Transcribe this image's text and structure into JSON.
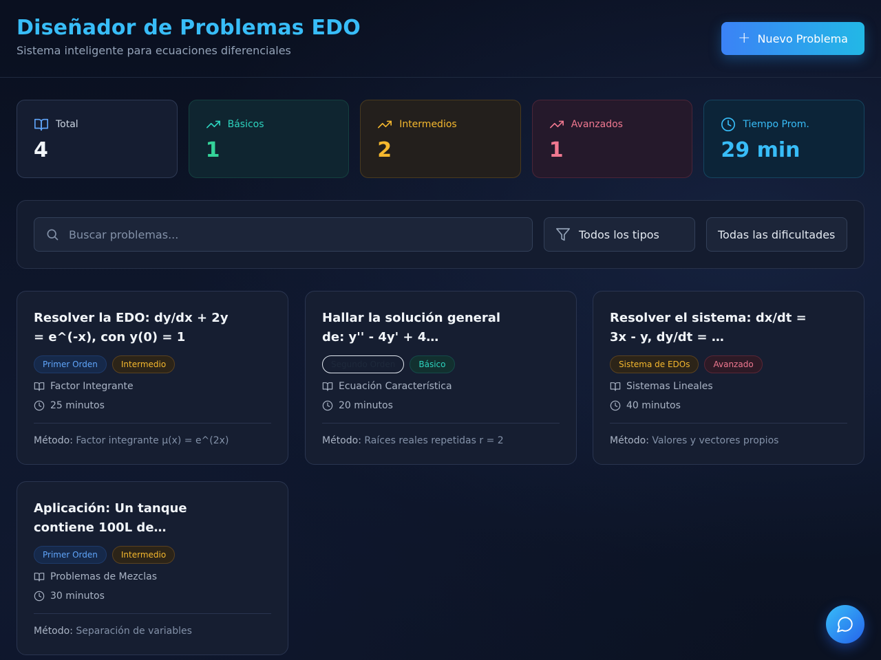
{
  "header": {
    "title": "Diseñador de Problemas EDO",
    "subtitle": "Sistema inteligente para ecuaciones diferenciales",
    "new_button": "Nuevo Problema"
  },
  "stats": {
    "total": {
      "label": "Total",
      "value": "4",
      "icon": "book-open-icon"
    },
    "basic": {
      "label": "Básicos",
      "value": "1",
      "icon": "trending-up-icon"
    },
    "intermediate": {
      "label": "Intermedios",
      "value": "2",
      "icon": "trending-up-icon"
    },
    "advanced": {
      "label": "Avanzados",
      "value": "1",
      "icon": "trending-up-icon"
    },
    "avg_time": {
      "label": "Tiempo Prom.",
      "value": "29 min",
      "icon": "clock-icon"
    }
  },
  "filters": {
    "search_placeholder": "Buscar problemas...",
    "search_value": "",
    "type_select": "Todos los tipos",
    "difficulty_select": "Todas las dificultades"
  },
  "method_label": "Método:",
  "problems": [
    {
      "title": "Resolver la EDO: dy/dx + 2y = e^(-x), con y(0) = 1",
      "type": "Primer Orden",
      "difficulty": "Intermedio",
      "topic": "Factor Integrante",
      "time": "25 minutos",
      "method": "Factor integrante μ(x) = e^(2x)"
    },
    {
      "title": "Hallar la solución general de: y'' - 4y' + 4…",
      "type": "Segundo Orden",
      "difficulty": "Básico",
      "topic": "Ecuación Característica",
      "time": "20 minutos",
      "method": "Raíces reales repetidas r = 2"
    },
    {
      "title": "Resolver el sistema: dx/dt = 3x - y, dy/dt = …",
      "type": "Sistema de EDOs",
      "difficulty": "Avanzado",
      "topic": "Sistemas Lineales",
      "time": "40 minutos",
      "method": "Valores y vectores propios"
    },
    {
      "title": "Aplicación: Un tanque contiene 100L de…",
      "type": "Primer Orden",
      "difficulty": "Intermedio",
      "topic": "Problemas de Mezclas",
      "time": "30 minutos",
      "method": "Separación de variables"
    }
  ],
  "colors": {
    "accent": "#38bdf8",
    "basic": "#34d399",
    "intermediate": "#f5b82e",
    "advanced": "#f07890"
  }
}
